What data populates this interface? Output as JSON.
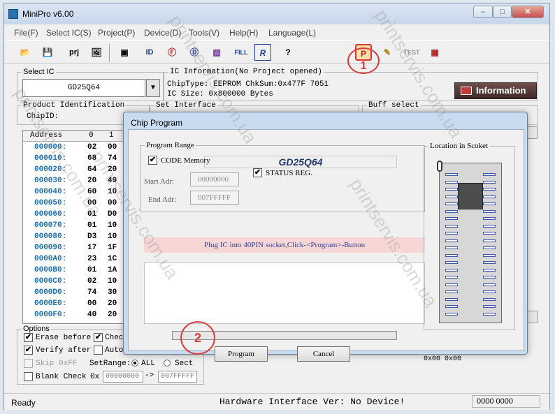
{
  "window": {
    "title": "MiniPro v6.00",
    "min_label": "–",
    "max_label": "□",
    "close_label": "✕"
  },
  "menu": [
    "File(F)",
    "Select IC(S)",
    "Project(P)",
    "Device(D)",
    "Tools(V)",
    "Help(H)",
    "Language(L)"
  ],
  "toolbar": {
    "prj_label": "prj",
    "id_label": "ID",
    "fill_label": "FILL",
    "r_label": "R",
    "help_label": "?",
    "p_label": "P",
    "test_label": "TEST"
  },
  "select_ic": {
    "title": "Select IC",
    "value": "GD25Q64",
    "arrow": "▼"
  },
  "ic_info": {
    "title": "IC Information(No Project opened)",
    "chip_type": "ChipType:  EEPROM   ChkSum:0x477F 7051",
    "ic_size": "IC Size:   0x800000 Bytes",
    "button": "Information"
  },
  "product_id": {
    "title": "Product Identification",
    "chip_id": "ChipID:"
  },
  "set_interface": {
    "title": "Set Interface"
  },
  "buff_select": {
    "title": "Buff select"
  },
  "hex_table": {
    "headers": [
      "Address",
      "0",
      "1"
    ],
    "rows": [
      {
        "addr": "000000:",
        "b0": "02",
        "b1": "00"
      },
      {
        "addr": "000010:",
        "b0": "68",
        "b1": "74"
      },
      {
        "addr": "000020:",
        "b0": "64",
        "b1": "20"
      },
      {
        "addr": "000030:",
        "b0": "20",
        "b1": "49"
      },
      {
        "addr": "000040:",
        "b0": "60",
        "b1": "10"
      },
      {
        "addr": "000050:",
        "b0": "00",
        "b1": "00"
      },
      {
        "addr": "000060:",
        "b0": "01",
        "b1": "D0"
      },
      {
        "addr": "000070:",
        "b0": "01",
        "b1": "10"
      },
      {
        "addr": "000080:",
        "b0": "D3",
        "b1": "10"
      },
      {
        "addr": "000090:",
        "b0": "17",
        "b1": "1F"
      },
      {
        "addr": "0000A0:",
        "b0": "23",
        "b1": "1C"
      },
      {
        "addr": "0000B0:",
        "b0": "01",
        "b1": "1A"
      },
      {
        "addr": "0000C0:",
        "b0": "02",
        "b1": "10"
      },
      {
        "addr": "0000D0:",
        "b0": "74",
        "b1": "30"
      },
      {
        "addr": "0000E0:",
        "b0": "00",
        "b1": "20"
      },
      {
        "addr": "0000F0:",
        "b0": "40",
        "b1": "20"
      }
    ]
  },
  "options": {
    "title": "Options",
    "erase_before": "Erase before",
    "verify_after": "Verify after",
    "skip_0xff": "Skip 0xFF",
    "blank_check": "Blank Check",
    "check": "Check",
    "auto": "Auto",
    "set_range": "SetRange:",
    "all": "ALL",
    "sect": "Sect",
    "range_prefix": "0x",
    "range_start": "00000000",
    "range_arrow": "->",
    "range_end": "007FFFFF"
  },
  "right_panel": {
    "partial_text": "0x00 0x00"
  },
  "statusbar": {
    "status": "Ready",
    "hardware": "Hardware Interface Ver: No Device!",
    "code": "0000 0000"
  },
  "dialog": {
    "title": "Chip Program",
    "program_range": "Program Range",
    "chip_name": "GD25Q64",
    "code_memory": "CODE Memory",
    "status_reg": "STATUS REG.",
    "start_label": "Start Adr:",
    "start_value": "00000000",
    "end_label": "End Adr:",
    "end_value": "007FFFFF",
    "message": "Plug IC into 40PIN socket,Click-<Program>-Button",
    "socket_title": "Location in Scoket",
    "program_button": "Program",
    "cancel_button": "Cancel"
  },
  "callouts": [
    "1",
    "2"
  ],
  "watermark": "printservis.com.ua"
}
